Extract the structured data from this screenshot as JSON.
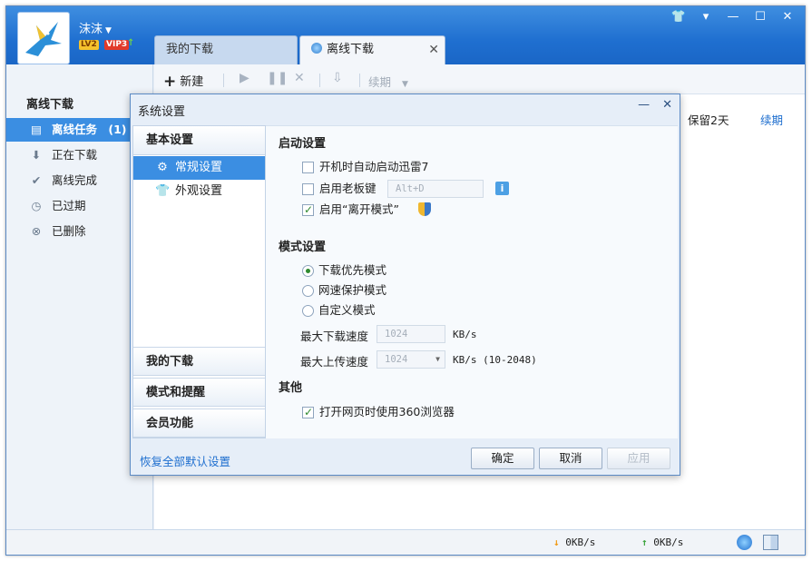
{
  "window": {
    "user_name": "沫沫",
    "badges": {
      "level": "LV2",
      "vip": "VIP3"
    },
    "controls": [
      "skin",
      "menu",
      "minimize",
      "maximize",
      "close"
    ]
  },
  "tabs": [
    {
      "label": "我的下载",
      "active": false
    },
    {
      "label": "离线下载",
      "active": true,
      "close": "✕"
    }
  ],
  "sidebar": {
    "title": "离线下载",
    "items": [
      {
        "label": "离线任务",
        "count": "(1)",
        "icon": "document-icon",
        "active": true
      },
      {
        "label": "正在下载",
        "icon": "download-arrow-icon"
      },
      {
        "label": "离线完成",
        "icon": "check-icon"
      },
      {
        "label": "已过期",
        "icon": "clock-icon"
      },
      {
        "label": "已删除",
        "icon": "delete-circle-icon"
      }
    ]
  },
  "toolbar": {
    "new_label": "新建",
    "renew_label": "续期"
  },
  "task_row": {
    "retention": "保留2天",
    "renew_link": "续期"
  },
  "status": {
    "down_speed": "0KB/s",
    "up_speed": "0KB/s"
  },
  "dialog": {
    "title": "系统设置",
    "nav": {
      "basic": "基本设置",
      "general": "常规设置",
      "appearance": "外观设置",
      "my_downloads": "我的下载",
      "mode_alert": "模式和提醒",
      "member": "会员功能"
    },
    "startup": {
      "title": "启动设置",
      "autostart": "开机时自动启动迅雷7",
      "boss_key": "启用老板键",
      "boss_key_value": "Alt+D",
      "away_mode": "启用“离开模式”"
    },
    "mode": {
      "title": "模式设置",
      "download_first": "下载优先模式",
      "net_protect": "网速保护模式",
      "custom": "自定义模式",
      "max_down_label": "最大下载速度",
      "max_down_value": "1024",
      "max_down_unit": "KB/s",
      "max_up_label": "最大上传速度",
      "max_up_value": "1024",
      "max_up_unit": "KB/s (10-2048)"
    },
    "other": {
      "title": "其他",
      "use_360": "打开网页时使用360浏览器"
    },
    "restore_defaults": "恢复全部默认设置",
    "ok": "确定",
    "cancel": "取消",
    "apply": "应用"
  }
}
